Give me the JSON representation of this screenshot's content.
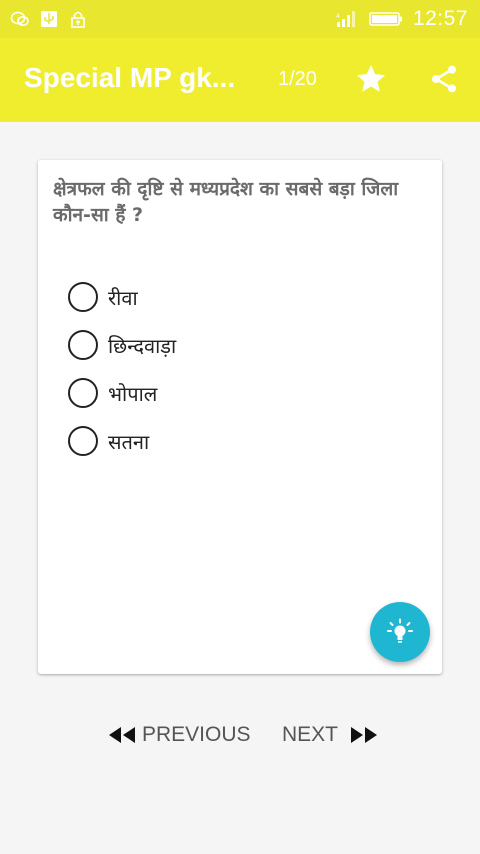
{
  "status_bar": {
    "time": "12:57",
    "left_icons": [
      "wechat-icon",
      "usb-icon",
      "lock-icon"
    ],
    "right_icons": [
      "signal-icon",
      "battery-icon"
    ]
  },
  "app_bar": {
    "title": "Special MP gk...",
    "counter": "1/20",
    "star_icon": "star-icon",
    "share_icon": "share-icon"
  },
  "question": {
    "text": "क्षेत्रफल की दृष्टि से मध्यप्रदेश का सबसे बड़ा जिला कौन-सा हैं ?",
    "options": [
      {
        "label": "रीवा"
      },
      {
        "label": "छिन्दवाड़ा"
      },
      {
        "label": "भोपाल"
      },
      {
        "label": "सतना"
      }
    ]
  },
  "hint": {
    "icon": "lightbulb-icon"
  },
  "navigation": {
    "previous_label": "PREVIOUS",
    "next_label": "NEXT"
  },
  "colors": {
    "status_bar": "#e8e62e",
    "app_bar": "#f0ed2f",
    "fab": "#1fb6d2",
    "background": "#f5f5f5"
  }
}
